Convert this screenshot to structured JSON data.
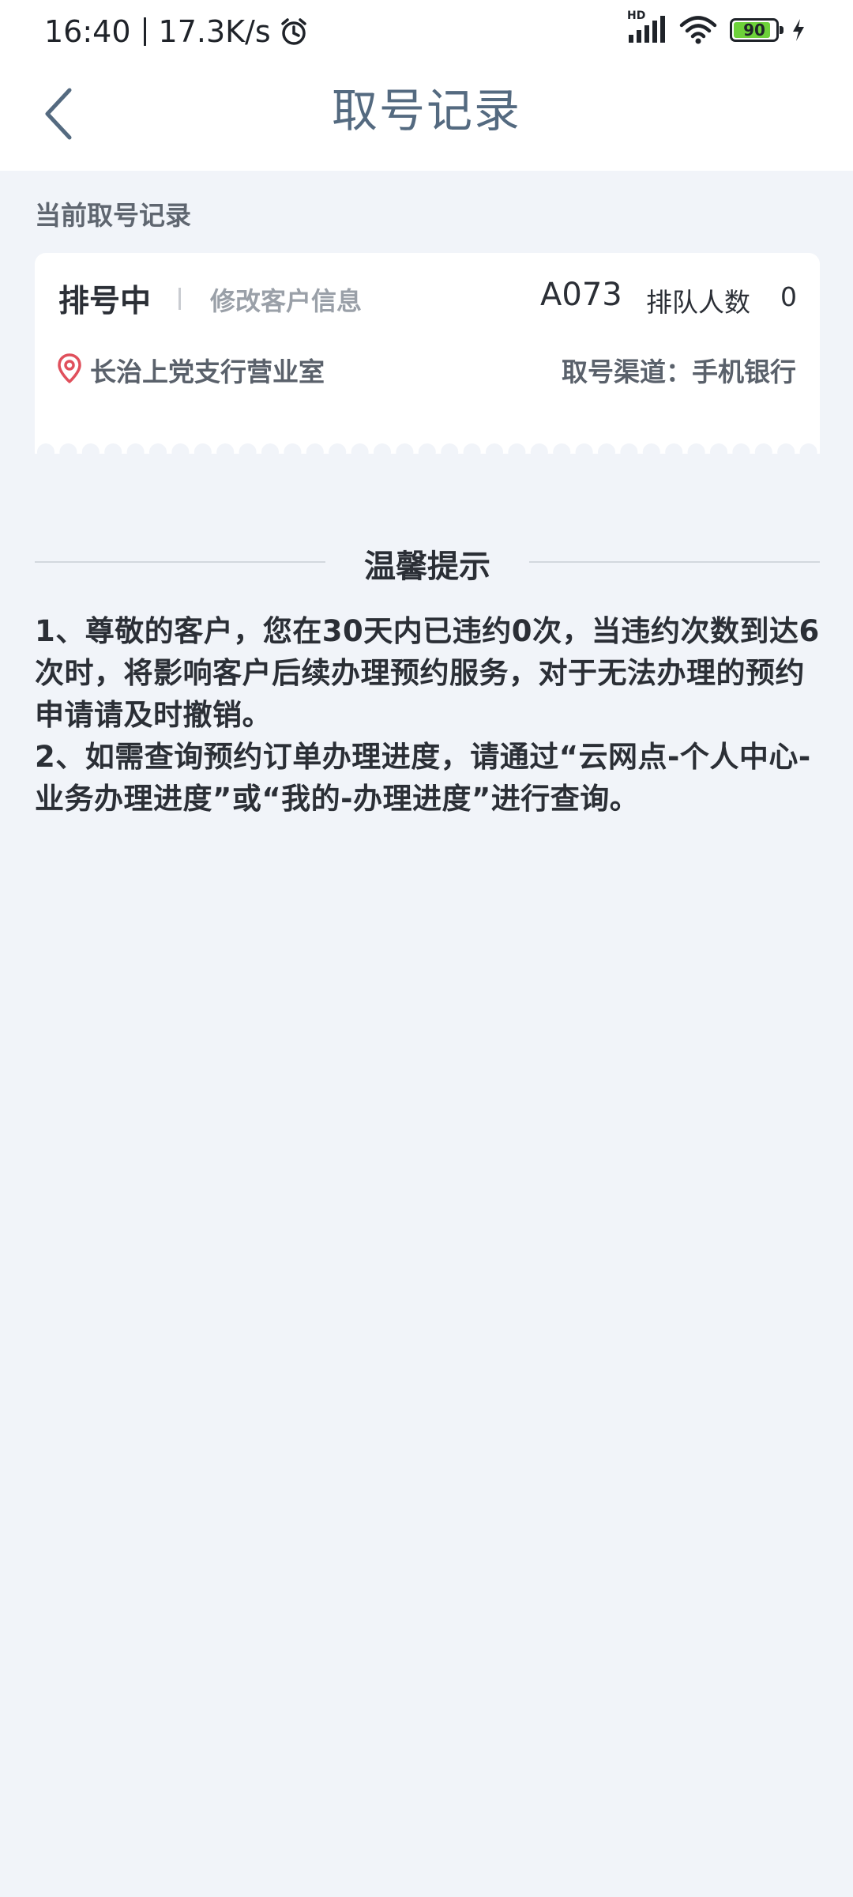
{
  "status_bar": {
    "time": "16:40",
    "net_speed": "17.3K/s",
    "signal_badge": "HD",
    "battery_level": "90",
    "battery_fraction": 0.9
  },
  "nav": {
    "title": "取号记录"
  },
  "current_section": {
    "label": "当前取号记录"
  },
  "record": {
    "status": "排号中",
    "modify_label": "修改客户信息",
    "ticket_number": "A073",
    "queue_label": "排队人数",
    "queue_count": "0",
    "branch": "长治上党支行营业室",
    "channel": "取号渠道：手机银行"
  },
  "tips": {
    "title": "温馨提示",
    "items": [
      "1、尊敬的客户，您在30天内已违约0次，当违约次数到达6次时，将影响客户后续办理预约服务，对于无法办理的预约申请请及时撤销。",
      "2、如需查询预约订单办理进度，请通过“云网点-个人中心-业务办理进度”或“我的-办理进度”进行查询。"
    ]
  },
  "colors": {
    "background": "#f1f4f9",
    "title": "#546a80",
    "location_pin": "#e0505c",
    "battery_fill": "#6dd13a"
  },
  "icons": {
    "back": "chevron-left-icon",
    "alarm": "alarm-clock-icon",
    "signal": "cellular-signal-icon",
    "wifi": "wifi-icon",
    "charging": "lightning-bolt-icon",
    "location": "location-pin-icon"
  }
}
